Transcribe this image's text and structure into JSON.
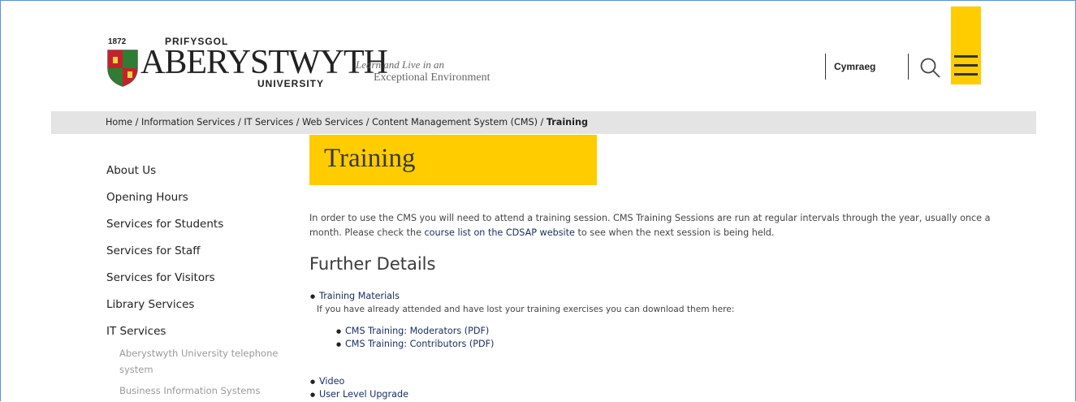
{
  "header": {
    "logo_year": "1872",
    "logo_prifysgol": "PRIFYSGOL",
    "logo_wordmark": "ABERYSTWYTH",
    "logo_university": "UNIVERSITY",
    "tagline_line1": "Learn and Live in an",
    "tagline_line2": "Exceptional Environment",
    "language_link": "Cymraeg",
    "search_icon": "search-icon",
    "menu_icon": "hamburger-menu-icon",
    "accent_color": "#ffcc00"
  },
  "breadcrumb": {
    "items": [
      "Home",
      "Information Services",
      "IT Services",
      "Web Services",
      "Content Management System (CMS)"
    ],
    "separator": " / ",
    "current": "Training"
  },
  "sidebar": {
    "items": [
      "About Us",
      "Opening Hours",
      "Services for Students",
      "Services for Staff",
      "Services for Visitors",
      "Library Services",
      "IT Services"
    ],
    "subitems": [
      "Aberystwyth University telephone system",
      "Business Information Systems"
    ]
  },
  "main": {
    "title": "Training",
    "intro_before": "In order to use the CMS you will need to attend a training session. CMS Training Sessions are run at regular intervals through the year, usually once a month. Please check the ",
    "intro_link": "course list on the CDSAP website",
    "intro_after": " to see when the next session is being held.",
    "section_heading": "Further Details",
    "list": {
      "training_materials": "Training Materials",
      "training_materials_desc": "If you have already attended and have lost your training exercises you can download them here:",
      "moderators": "CMS Training: Moderators (PDF)",
      "contributors": "CMS Training: Contributors (PDF)",
      "video": "Video",
      "user_level_upgrade": "User Level Upgrade"
    }
  }
}
